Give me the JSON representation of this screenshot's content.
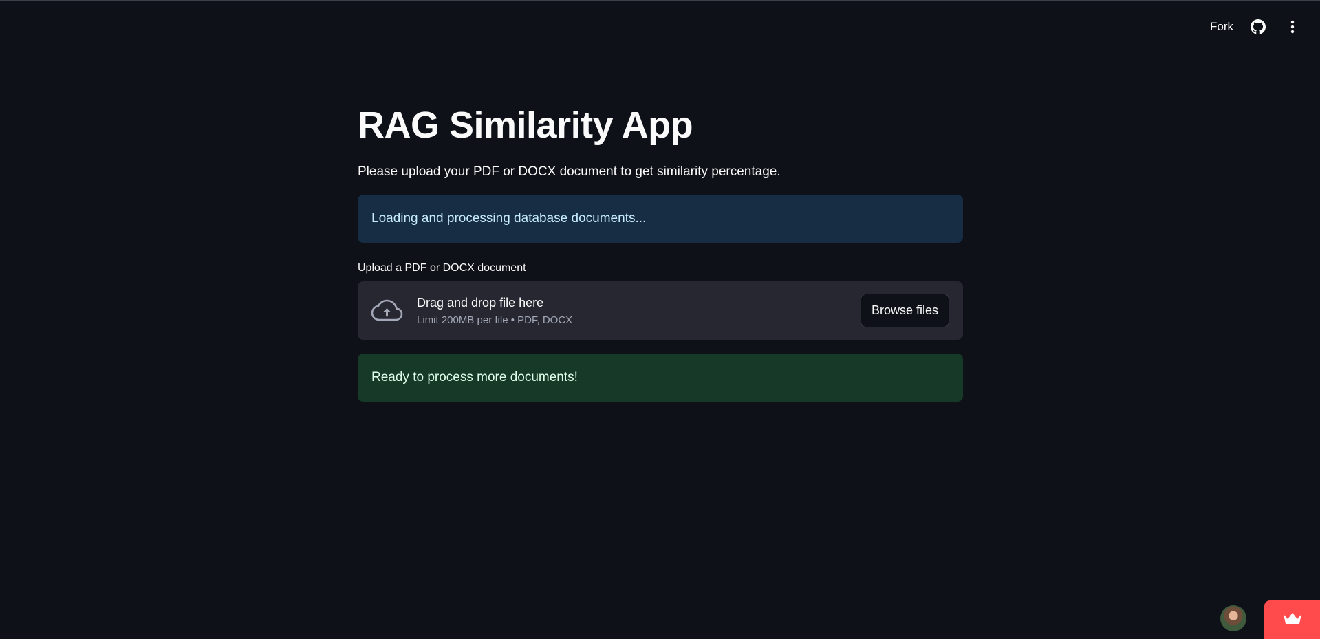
{
  "header": {
    "fork_label": "Fork",
    "github_icon": "github-icon",
    "menu_icon": "kebab-menu-icon"
  },
  "main": {
    "title": "RAG Similarity App",
    "subtitle": "Please upload your PDF or DOCX document to get similarity percentage.",
    "info_alert": "Loading and processing database documents...",
    "uploader": {
      "label": "Upload a PDF or DOCX document",
      "drop_text": "Drag and drop file here",
      "limit_text": "Limit 200MB per file • PDF, DOCX",
      "browse_label": "Browse files",
      "icon": "cloud-upload-icon"
    },
    "success_alert": "Ready to process more documents!"
  },
  "footer": {
    "avatar": "user-avatar",
    "badge_icon": "streamlit-crown-icon"
  },
  "colors": {
    "background": "#0e1117",
    "info_bg": "#172d43",
    "info_text": "#c7ebff",
    "success_bg": "#173928",
    "success_text": "#dffde9",
    "dropzone_bg": "#262730",
    "brand_red": "#ff4b4b"
  }
}
